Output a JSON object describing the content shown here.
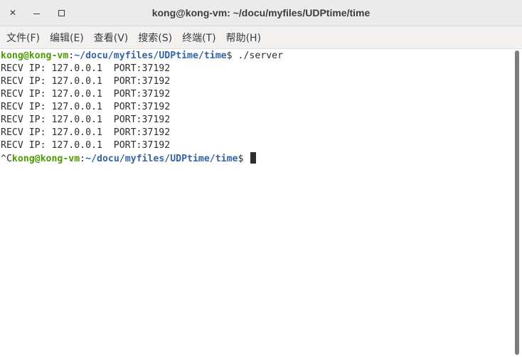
{
  "window": {
    "title": "kong@kong-vm: ~/docu/myfiles/UDPtime/time",
    "controls": {
      "close_icon": "close-icon",
      "close_glyph": "✕",
      "minimize_icon": "minimize-icon",
      "maximize_icon": "maximize-icon"
    }
  },
  "menubar": {
    "items": [
      {
        "label": "文件(F)"
      },
      {
        "label": "编辑(E)"
      },
      {
        "label": "查看(V)"
      },
      {
        "label": "搜索(S)"
      },
      {
        "label": "终端(T)"
      },
      {
        "label": "帮助(H)"
      }
    ]
  },
  "terminal": {
    "prompt_user_host": "kong@kong-vm",
    "prompt_colon": ":",
    "prompt_path": "~/docu/myfiles/UDPtime/time",
    "prompt_symbol": "$",
    "command": " ./server",
    "output_lines": [
      "RECV IP: 127.0.0.1  PORT:37192",
      "RECV IP: 127.0.0.1  PORT:37192",
      "RECV IP: 127.0.0.1  PORT:37192",
      "RECV IP: 127.0.0.1  PORT:37192",
      "RECV IP: 127.0.0.1  PORT:37192",
      "RECV IP: 127.0.0.1  PORT:37192",
      "RECV IP: 127.0.0.1  PORT:37192"
    ],
    "interrupt": "^C",
    "second_prompt_symbol": "$ "
  },
  "colors": {
    "prompt_user_host": "#4e9a06",
    "prompt_path": "#3465a4",
    "text": "#2f2f2f",
    "background": "#ffffff",
    "titlebar": "#ebebeb"
  }
}
